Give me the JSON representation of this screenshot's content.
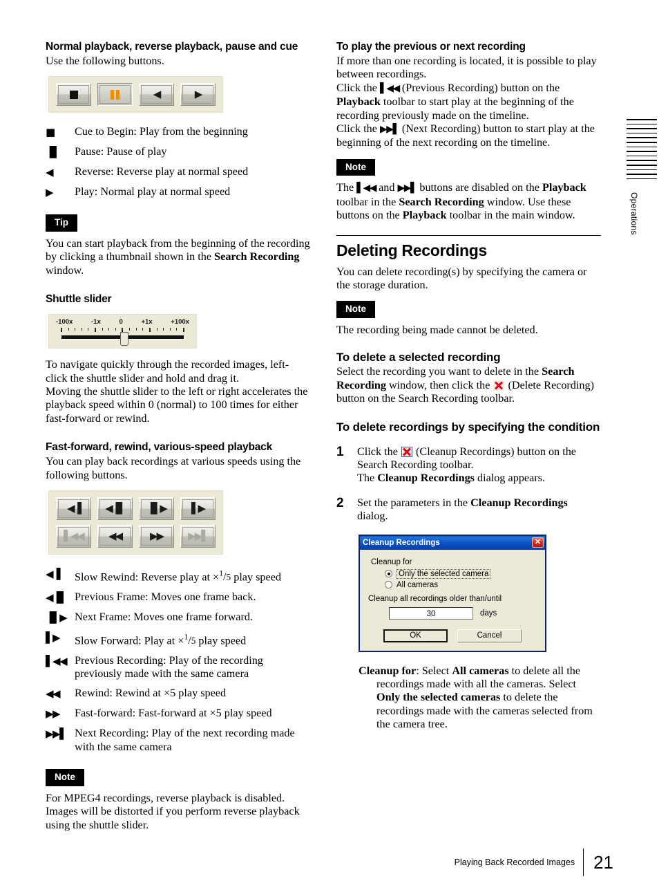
{
  "page": {
    "number": "21",
    "footer_text": "Playing Back Recorded Images",
    "edge_tab_label": "Operations"
  },
  "left_column": {
    "section1": {
      "heading": "Normal playback, reverse playback, pause and cue",
      "intro": "Use the following buttons.",
      "toolbar_buttons": [
        {
          "name": "cue-to-begin",
          "glyph": "■",
          "state": "normal"
        },
        {
          "name": "pause",
          "glyph": "▐▌",
          "state": "pressed"
        },
        {
          "name": "reverse",
          "glyph": "◀",
          "state": "normal"
        },
        {
          "name": "play",
          "glyph": "▶",
          "state": "normal"
        }
      ],
      "glyph_items": [
        {
          "glyph": "■",
          "text": "Cue to Begin: Play from the beginning"
        },
        {
          "glyph": "▐▌",
          "text": "Pause: Pause of play"
        },
        {
          "glyph": "◀",
          "text": "Reverse: Reverse play at normal speed"
        },
        {
          "glyph": "▶",
          "text": "Play: Normal play at normal speed"
        }
      ],
      "tip_badge": "Tip",
      "tip_text_1": "You can start playback from the beginning of the recording by clicking a thumbnail shown in the ",
      "tip_bold_1": "Search Recording",
      "tip_text_2": " window."
    },
    "section2": {
      "heading": "Shuttle slider",
      "slider": {
        "labels": [
          "-100x",
          "-1x",
          "0",
          "+1x",
          "+100x"
        ],
        "knob_position": "0"
      },
      "body": "To navigate quickly through the recorded images, left-click the shuttle slider and hold and drag it.\nMoving the shuttle slider to the left or right accelerates the playback speed within 0 (normal) to 100 times for either fast-forward or rewind."
    },
    "section3": {
      "heading": "Fast-forward, rewind, various-speed playback",
      "intro": "You can play back recordings at various speeds using the following buttons.",
      "toolbar_row1": [
        {
          "name": "slow-rewind",
          "glyph": "◀▐",
          "state": "normal"
        },
        {
          "name": "previous-frame",
          "glyph": "◀▐▌",
          "state": "normal"
        },
        {
          "name": "next-frame",
          "glyph": "▐▌▶",
          "state": "normal"
        },
        {
          "name": "slow-forward",
          "glyph": "▌▶",
          "state": "normal"
        }
      ],
      "toolbar_row2": [
        {
          "name": "previous-recording",
          "glyph": "▌◀◀",
          "state": "disabled"
        },
        {
          "name": "rewind",
          "glyph": "◀◀",
          "state": "normal"
        },
        {
          "name": "fast-forward",
          "glyph": "▶▶",
          "state": "normal"
        },
        {
          "name": "next-recording",
          "glyph": "▶▶▌",
          "state": "disabled"
        }
      ],
      "glyph_items": [
        {
          "glyph": "◀▐",
          "text_before": "Slow Rewind:  Reverse play at ×",
          "frac_num": "1",
          "frac_den": "5",
          "text_after": " play speed"
        },
        {
          "glyph": "◀▐▌",
          "text": "Previous Frame:  Moves one frame back."
        },
        {
          "glyph": "▐▌▶",
          "text": "Next Frame:  Moves one frame forward."
        },
        {
          "glyph": "▌▶",
          "text_before": "Slow Forward:  Play at ×",
          "frac_num": "1",
          "frac_den": "5",
          "text_after": " play speed"
        },
        {
          "glyph": "▌◀◀",
          "text": "Previous Recording:  Play of the recording previously made with the same camera"
        },
        {
          "glyph": "◀◀",
          "text": "Rewind:  Rewind at ×5 play speed"
        },
        {
          "glyph": "▶▶",
          "text": "Fast-forward:  Fast-forward at ×5 play speed"
        },
        {
          "glyph": "▶▶▌",
          "text": "Next Recording: Play of the next recording made with the same camera"
        }
      ],
      "note_badge": "Note",
      "note_text": "For MPEG4 recordings, reverse playback is disabled. Images will be distorted if you perform reverse playback using the shuttle slider."
    }
  },
  "right_column": {
    "section1": {
      "heading": "To play the previous or next recording",
      "para1": "If more than one recording is located, it is possible to play between recordings.",
      "para2_a": "Click the ",
      "para2_glyph": "▌◀◀",
      "para2_b": " (Previous Recording) button on the ",
      "para2_bold": "Playback",
      "para2_c": " toolbar to start play at the beginning of the recording previously made on the timeline.",
      "para3_a": "Click the ",
      "para3_glyph": "▶▶▌",
      "para3_b": " (Next Recording) button to start play at the beginning of the next recording on the timeline.",
      "note_badge": "Note",
      "note_a": "The ",
      "note_glyph1": "▌◀◀",
      "note_b": " and ",
      "note_glyph2": "▶▶▌",
      "note_c": " buttons are disabled on the ",
      "note_bold1": "Playback",
      "note_d": " toolbar in the ",
      "note_bold2": "Search Recording",
      "note_e": " window.  Use these buttons on the ",
      "note_bold3": "Playback",
      "note_f": " toolbar in the main window."
    },
    "section2": {
      "heading": "Deleting Recordings",
      "intro": "You can delete recording(s) by specifying the camera or the storage duration.",
      "note_badge": "Note",
      "note_text": "The recording being made cannot be deleted.",
      "sub1_heading": "To delete a selected recording",
      "sub1_a": "Select the recording you want to delete in the ",
      "sub1_bold": "Search Recording",
      "sub1_b": " window, then click the ",
      "sub1_c": " (Delete Recording) button on the Search Recording toolbar.",
      "sub2_heading": "To delete recordings by specifying the condition",
      "steps": [
        {
          "num": "1",
          "a": "Click the ",
          "b": " (Cleanup Recordings) button on the Search Recording toolbar.",
          "c_a": "The ",
          "c_bold": "Cleanup Recordings",
          "c_b": " dialog appears."
        },
        {
          "num": "2",
          "a": "Set the parameters in the ",
          "bold": "Cleanup Recordings",
          "b": " dialog."
        }
      ],
      "definition": {
        "term": "Cleanup for",
        "text_a": ":  Select ",
        "bold_a": "All cameras",
        "text_b": " to delete all the recordings made with all the cameras.  Select ",
        "bold_b": "Only the selected cameras",
        "text_c": " to delete the recordings made with the cameras selected from the camera tree."
      }
    },
    "dialog": {
      "title": "Cleanup Recordings",
      "close_label": "✕",
      "group_label": "Cleanup for",
      "radio_options": [
        {
          "label": "Only the selected camera",
          "selected": true
        },
        {
          "label": "All cameras",
          "selected": false
        }
      ],
      "field_label": "Cleanup all recordings older than/until",
      "field_value": "30",
      "field_unit": "days",
      "ok_label": "OK",
      "cancel_label": "Cancel"
    }
  },
  "colors": {
    "toolbar_bg": "#EDE9D8",
    "pause_orange": "#F08C00",
    "delete_red": "#E2001A",
    "dialog_titlebar": "#0A4FC0",
    "dialog_face": "#ECE9D8"
  }
}
